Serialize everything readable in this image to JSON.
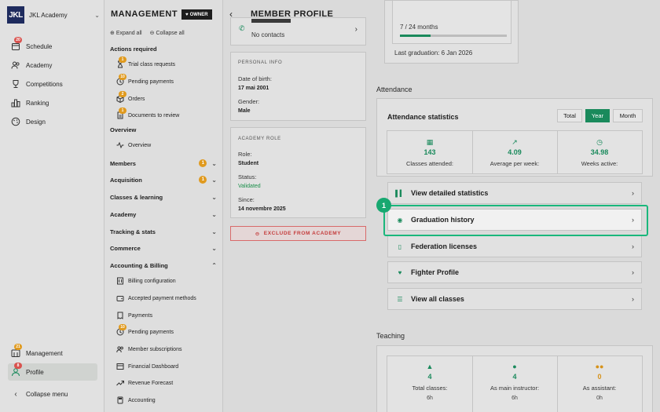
{
  "brand": {
    "logo": "JKL",
    "name": "JKL Academy"
  },
  "nav": {
    "items": [
      {
        "label": "Schedule",
        "icon": "calendar-icon",
        "badge": "20"
      },
      {
        "label": "Academy",
        "icon": "people-icon",
        "badge": ""
      },
      {
        "label": "Competitions",
        "icon": "trophy-icon",
        "badge": ""
      },
      {
        "label": "Ranking",
        "icon": "ranking-icon",
        "badge": ""
      },
      {
        "label": "Design",
        "icon": "palette-icon",
        "badge": ""
      }
    ],
    "bottom": [
      {
        "label": "Management",
        "icon": "management-icon",
        "badge": "21"
      },
      {
        "label": "Profile",
        "icon": "profile-icon",
        "badge": "8"
      }
    ],
    "collapse": "Collapse menu"
  },
  "management": {
    "title": "MANAGEMENT",
    "owner_badge": "OWNER",
    "expand_all": "Expand all",
    "collapse_all": "Collapse all",
    "actions_required": {
      "title": "Actions required",
      "items": [
        {
          "label": "Trial class requests",
          "badge": "1"
        },
        {
          "label": "Pending payments",
          "badge": "10"
        },
        {
          "label": "Orders",
          "badge": "2"
        },
        {
          "label": "Documents to review",
          "badge": "1"
        }
      ]
    },
    "overview": {
      "title": "Overview",
      "item": "Overview"
    },
    "groups": [
      {
        "label": "Members",
        "badge": "1"
      },
      {
        "label": "Acquisition",
        "badge": "1"
      },
      {
        "label": "Classes & learning",
        "badge": ""
      },
      {
        "label": "Academy",
        "badge": ""
      },
      {
        "label": "Tracking & stats",
        "badge": ""
      },
      {
        "label": "Commerce",
        "badge": ""
      }
    ],
    "billing": {
      "title": "Accounting & Billing",
      "items": [
        {
          "label": "Billing configuration",
          "badge": ""
        },
        {
          "label": "Accepted payment methods",
          "badge": ""
        },
        {
          "label": "Payments",
          "badge": ""
        },
        {
          "label": "Pending payments",
          "badge": "10"
        },
        {
          "label": "Member subscriptions",
          "badge": ""
        },
        {
          "label": "Financial Dashboard",
          "badge": ""
        },
        {
          "label": "Revenue Forecast",
          "badge": ""
        },
        {
          "label": "Accounting",
          "badge": ""
        }
      ]
    }
  },
  "profile": {
    "title": "MEMBER PROFILE",
    "contacts_label": "No contacts",
    "personal_info": {
      "title": "PERSONAL INFO",
      "dob_label": "Date of birth:",
      "dob_value": "17 mai 2001",
      "gender_label": "Gender:",
      "gender_value": "Male"
    },
    "academy_role": {
      "title": "ACADEMY ROLE",
      "role_label": "Role:",
      "role_value": "Student",
      "status_label": "Status:",
      "status_value": "Validated",
      "since_label": "Since:",
      "since_value": "14 novembre 2025"
    },
    "exclude_button": "EXCLUDE FROM ACADEMY",
    "graduation": {
      "progress_text": "7 / 24 months",
      "progress_fraction": 0.29,
      "last_graduation": "Last graduation: 6 Jan 2026"
    },
    "attendance": {
      "section_title": "Attendance",
      "stats_title": "Attendance statistics",
      "toggles": [
        "Total",
        "Year",
        "Month"
      ],
      "active_toggle": "Year",
      "stats": [
        {
          "value": "143",
          "label": "Classes attended:"
        },
        {
          "value": "4.09",
          "label": "Average per week:"
        },
        {
          "value": "34.98",
          "label": "Weeks active:"
        }
      ]
    },
    "links": [
      {
        "label": "View detailed statistics",
        "icon": "bar-chart-icon"
      },
      {
        "label": "Graduation history",
        "icon": "medal-icon"
      },
      {
        "label": "Federation licenses",
        "icon": "license-icon"
      },
      {
        "label": "Fighter Profile",
        "icon": "heart-icon"
      },
      {
        "label": "View all classes",
        "icon": "list-icon"
      }
    ],
    "highlight_marker": "1",
    "teaching": {
      "section_title": "Teaching",
      "stats": [
        {
          "value": "4",
          "label": "Total classes:",
          "sub": "6h"
        },
        {
          "value": "4",
          "label": "As main instructor:",
          "sub": "6h"
        },
        {
          "value": "0",
          "label": "As assistant:",
          "sub": "0h"
        }
      ]
    }
  },
  "colors": {
    "accent": "#1a8a5c",
    "highlight": "#1ab77c",
    "danger": "#c43c3c",
    "badge_orange": "#e09a1e",
    "badge_red": "#d9534f"
  }
}
